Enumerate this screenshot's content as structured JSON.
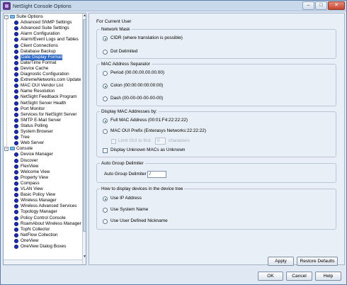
{
  "window": {
    "title": "NetSight Console Options",
    "buttons": {
      "minimize": "–",
      "maximize": "□",
      "close": "✕"
    }
  },
  "tree": {
    "suite": {
      "label": "Suite Options",
      "items": [
        "Advanced SNMP Settings",
        "Advanced Suite Settings",
        "Alarm Configuration",
        "Alarm/Event Logs and Tables",
        "Client Connections",
        "Database Backup",
        "Date Display Format",
        "Date/Time Format",
        "Device Cache",
        "Diagnostic Configuration",
        "ExtremeNetworks.com Update",
        "MAC OUI Vendor List",
        "Name Resolution",
        "NetSight Feedback Program",
        "NetSight Server Health",
        "Port Monitor",
        "Services for NetSight Server",
        "SMTP E-Mail Server",
        "Status Polling",
        "System Browser",
        "Tree",
        "Web Server"
      ],
      "selected_index": 6
    },
    "console": {
      "label": "Console",
      "items": [
        "Device Manager",
        "Discover",
        "FlexView",
        "Welcome View",
        "Property View",
        "Compass",
        "VLAN View",
        "Basic Policy View",
        "Wireless Manager",
        "Wireless Advanced Services",
        "Topology Manager",
        "Policy Control Console",
        "RoamAbout Wireless Manager",
        "TopN Collector",
        "NetFlow Collection",
        "OneView",
        "OneView Dialog Boxes"
      ]
    }
  },
  "panel": {
    "heading": "For Current User",
    "network_mask": {
      "title": "Network Mask",
      "options": [
        "CIDR (where translation is possible)",
        "Dot Delimited"
      ],
      "selected": 0
    },
    "mac_separator": {
      "title": "MAC Address Separator",
      "options": [
        "Period (00.00.00.00.00.00)",
        "Colon (00:00:00:00:00:00)",
        "Dash (00-00-00-00-00-00)"
      ],
      "selected": 1
    },
    "display_mac": {
      "title": "Display MAC Addresses by:",
      "options": [
        "Full MAC Address (00:01:F4:22:22:22)",
        "MAC OUI Prefix (Enterasys Networks:22:22:22)"
      ],
      "selected": 0,
      "limit_label": "Limit OUI to first",
      "limit_value": "0",
      "limit_suffix": "characters",
      "unknown_label": "Display Unknown MACs as Unknown"
    },
    "auto_group": {
      "title": "Auto Group Delimiter",
      "label": "Auto Group Delimiter",
      "value": "/"
    },
    "device_tree": {
      "title": "How to display devices in the device tree",
      "options": [
        "Use IP Address",
        "Use System Name",
        "Use User Defined Nickname"
      ],
      "selected": 0
    }
  },
  "buttons": {
    "apply": "Apply",
    "restore": "Restore Defaults",
    "ok": "OK",
    "cancel": "Cancel",
    "help": "Help"
  },
  "colors": {
    "selection": "#316ac5",
    "tree_dot": "#1c2fb6",
    "window_bg": "#dfe8f3"
  }
}
